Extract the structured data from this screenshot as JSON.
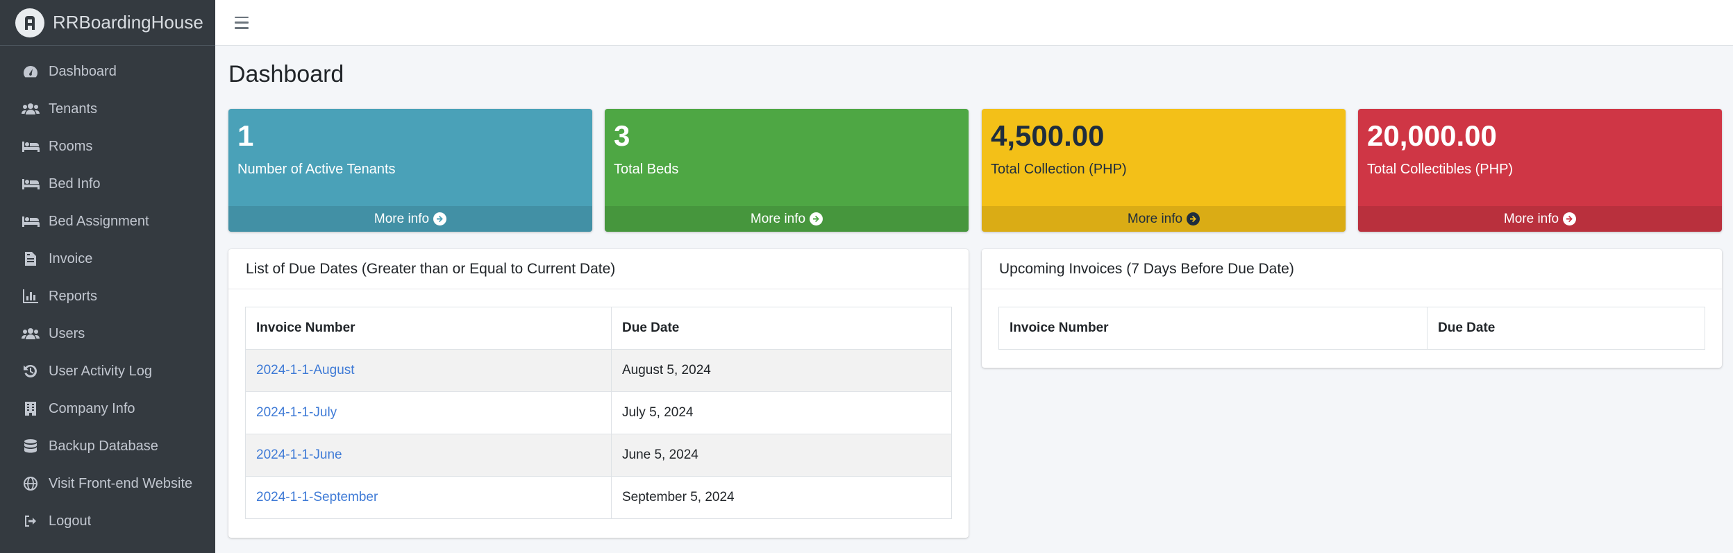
{
  "brand": {
    "name": "RRBoardingHouse"
  },
  "sidebar": {
    "items": [
      {
        "label": "Dashboard",
        "icon": "tachometer-icon"
      },
      {
        "label": "Tenants",
        "icon": "users-icon"
      },
      {
        "label": "Rooms",
        "icon": "bed-icon"
      },
      {
        "label": "Bed Info",
        "icon": "bed-icon"
      },
      {
        "label": "Bed Assignment",
        "icon": "bed-icon"
      },
      {
        "label": "Invoice",
        "icon": "file-invoice-icon"
      },
      {
        "label": "Reports",
        "icon": "chart-bar-icon"
      },
      {
        "label": "Users",
        "icon": "users-icon"
      },
      {
        "label": "User Activity Log",
        "icon": "history-icon"
      },
      {
        "label": "Company Info",
        "icon": "building-icon"
      },
      {
        "label": "Backup Database",
        "icon": "database-icon"
      },
      {
        "label": "Visit Front-end Website",
        "icon": "globe-icon"
      },
      {
        "label": "Logout",
        "icon": "sign-out-icon"
      }
    ]
  },
  "page": {
    "title": "Dashboard"
  },
  "stats": [
    {
      "value": "1",
      "label": "Number of Active Tenants",
      "more": "More info",
      "color": "#4aa1b8"
    },
    {
      "value": "3",
      "label": "Total Beds",
      "more": "More info",
      "color": "#4ea744"
    },
    {
      "value": "4,500.00",
      "label": "Total Collection (PHP)",
      "more": "More info",
      "color": "#f3c018"
    },
    {
      "value": "20,000.00",
      "label": "Total Collectibles (PHP)",
      "more": "More info",
      "color": "#cf3645"
    }
  ],
  "due_dates": {
    "title": "List of Due Dates (Greater than or Equal to Current Date)",
    "columns": [
      "Invoice Number",
      "Due Date"
    ],
    "rows": [
      [
        "2024-1-1-August",
        "August 5, 2024"
      ],
      [
        "2024-1-1-July",
        "July 5, 2024"
      ],
      [
        "2024-1-1-June",
        "June 5, 2024"
      ],
      [
        "2024-1-1-September",
        "September 5, 2024"
      ]
    ]
  },
  "upcoming": {
    "title": "Upcoming Invoices (7 Days Before Due Date)",
    "columns": [
      "Invoice Number",
      "Due Date"
    ]
  }
}
